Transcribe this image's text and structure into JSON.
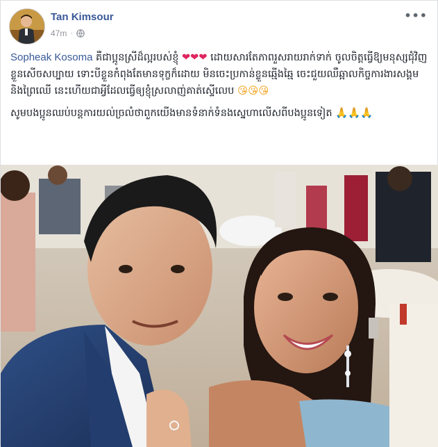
{
  "post": {
    "author": "Tan Kimsour",
    "time": "47m",
    "separator": "·",
    "more": "•••"
  },
  "text": {
    "mention": "Sopheak Kosoma",
    "para1": "គឺជាប្អូនស្រីដ៏ល្អរបស់ខ្ញុំ",
    "para1_hearts": "❤❤❤",
    "para1_rest": "ដោយសារតែភាពរួសរាយរាក់ទាក់ ចូលចិត្តធ្វើឱ្យមនុស្សជុំវិញខ្លួនសើចសប្បាយ ទោះបីខ្លួនកំពុងតែមានទុក្ខក៏ដោយ មិនចេះប្រកាន់ខ្លួនឆ្មើងឆ្មៃ ចេះជួយឈឺឆ្អាលកិច្ចការងារសង្គមនិងព្រៃឈើ នេះហើយជាអ្វីដែលធ្វើឲ្យខ្ញុំស្រលាញ់គាត់ស្ទើលេប",
    "para1_kisses": "😘😘😘",
    "para2": "សូមបងប្អូនឈប់បន្តការយល់ច្រលំថាពួកយើងមានទំនាក់ទំនងស្នេហាលើសពីបងប្អូនទៀត",
    "para2_pray": "🙏🙏🙏"
  },
  "icons": {
    "globe": "globe-icon",
    "more": "more-options-icon"
  },
  "colors": {
    "author": "#385898",
    "meta": "#90949c",
    "text": "#1d2129"
  }
}
